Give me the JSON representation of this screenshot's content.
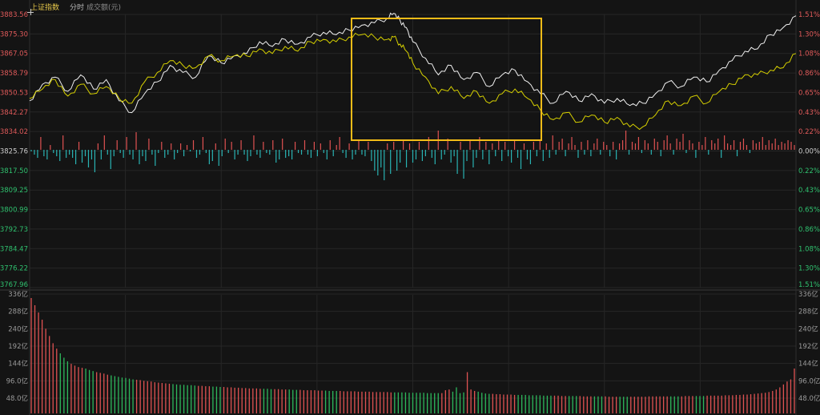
{
  "header": {
    "title": "上证指数",
    "mode": "分时",
    "volume_label": "成交额(元)"
  },
  "colors": {
    "background": "#141414",
    "grid": "#262626",
    "up": "#e05252",
    "down": "#29b3b3",
    "index_line": "#f0f0f0",
    "avg_line": "#d6d000",
    "label_red": "#e05a5a",
    "label_green": "#2fc06e",
    "label_neutral": "#cfcfcf",
    "highlight_box": "#f2bc18"
  },
  "chart_data": [
    {
      "type": "line",
      "name": "price",
      "y_axis_left": {
        "labels": [
          "3883.56",
          "3875.30",
          "3867.05",
          "3858.79",
          "3850.53",
          "3842.27",
          "3834.02",
          "3825.76",
          "3817.50",
          "3809.25",
          "3800.99",
          "3792.73",
          "3784.47",
          "3776.22",
          "3767.96"
        ],
        "ylim": [
          3767.96,
          3883.56
        ]
      },
      "y_axis_right": {
        "labels": [
          "1.51%",
          "1.30%",
          "1.08%",
          "0.86%",
          "0.65%",
          "0.43%",
          "0.22%",
          "0.00%",
          "0.22%",
          "0.43%",
          "0.65%",
          "0.86%",
          "1.08%",
          "1.30%",
          "1.51%"
        ]
      },
      "x_range": [
        0,
        240
      ],
      "series": [
        {
          "points": [
            [
              0,
              3847
            ],
            [
              4,
              3854
            ],
            [
              8,
              3857
            ],
            [
              12,
              3851
            ],
            [
              16,
              3858
            ],
            [
              20,
              3852
            ],
            [
              24,
              3856
            ],
            [
              28,
              3847
            ],
            [
              32,
              3842
            ],
            [
              36,
              3850
            ],
            [
              40,
              3855
            ],
            [
              44,
              3862
            ],
            [
              48,
              3859
            ],
            [
              52,
              3857
            ],
            [
              56,
              3866
            ],
            [
              60,
              3863
            ],
            [
              64,
              3866
            ],
            [
              68,
              3867
            ],
            [
              72,
              3872
            ],
            [
              76,
              3870
            ],
            [
              80,
              3873
            ],
            [
              84,
              3871
            ],
            [
              88,
              3874
            ],
            [
              92,
              3876
            ],
            [
              96,
              3875
            ],
            [
              100,
              3877
            ],
            [
              104,
              3879
            ],
            [
              108,
              3880
            ],
            [
              112,
              3882
            ],
            [
              114,
              3884
            ],
            [
              116,
              3881
            ],
            [
              118,
              3878
            ],
            [
              120,
              3872
            ],
            [
              124,
              3865
            ],
            [
              128,
              3858
            ],
            [
              132,
              3862
            ],
            [
              136,
              3856
            ],
            [
              140,
              3859
            ],
            [
              144,
              3853
            ],
            [
              148,
              3858
            ],
            [
              152,
              3860
            ],
            [
              156,
              3855
            ],
            [
              160,
              3850
            ],
            [
              164,
              3846
            ],
            [
              168,
              3851
            ],
            [
              172,
              3847
            ],
            [
              176,
              3850
            ],
            [
              180,
              3846
            ],
            [
              184,
              3848
            ],
            [
              188,
              3845
            ],
            [
              192,
              3846
            ],
            [
              196,
              3850
            ],
            [
              200,
              3855
            ],
            [
              204,
              3853
            ],
            [
              208,
              3857
            ],
            [
              212,
              3855
            ],
            [
              216,
              3860
            ],
            [
              220,
              3864
            ],
            [
              224,
              3868
            ],
            [
              228,
              3869
            ],
            [
              232,
              3875
            ],
            [
              236,
              3878
            ],
            [
              240,
              3883
            ]
          ]
        },
        {
          "points": [
            [
              0,
              3848
            ],
            [
              4,
              3852
            ],
            [
              8,
              3856
            ],
            [
              12,
              3849
            ],
            [
              16,
              3854
            ],
            [
              20,
              3850
            ],
            [
              24,
              3853
            ],
            [
              28,
              3848
            ],
            [
              32,
              3846
            ],
            [
              36,
              3855
            ],
            [
              40,
              3859
            ],
            [
              44,
              3864
            ],
            [
              48,
              3862
            ],
            [
              52,
              3861
            ],
            [
              56,
              3866
            ],
            [
              60,
              3864
            ],
            [
              64,
              3866
            ],
            [
              68,
              3866
            ],
            [
              72,
              3869
            ],
            [
              76,
              3867
            ],
            [
              80,
              3870
            ],
            [
              84,
              3868
            ],
            [
              88,
              3872
            ],
            [
              92,
              3873
            ],
            [
              96,
              3872
            ],
            [
              100,
              3874
            ],
            [
              104,
              3875
            ],
            [
              108,
              3874
            ],
            [
              112,
              3873
            ],
            [
              114,
              3874
            ],
            [
              116,
              3871
            ],
            [
              118,
              3868
            ],
            [
              120,
              3863
            ],
            [
              124,
              3857
            ],
            [
              128,
              3850
            ],
            [
              132,
              3853
            ],
            [
              136,
              3848
            ],
            [
              140,
              3851
            ],
            [
              144,
              3846
            ],
            [
              148,
              3850
            ],
            [
              152,
              3852
            ],
            [
              156,
              3848
            ],
            [
              160,
              3843
            ],
            [
              164,
              3839
            ],
            [
              168,
              3842
            ],
            [
              172,
              3838
            ],
            [
              176,
              3841
            ],
            [
              180,
              3838
            ],
            [
              184,
              3840
            ],
            [
              188,
              3836
            ],
            [
              192,
              3836
            ],
            [
              196,
              3841
            ],
            [
              200,
              3847
            ],
            [
              204,
              3845
            ],
            [
              208,
              3849
            ],
            [
              212,
              3846
            ],
            [
              216,
              3851
            ],
            [
              220,
              3854
            ],
            [
              224,
              3858
            ],
            [
              228,
              3858
            ],
            [
              232,
              3860
            ],
            [
              236,
              3861
            ],
            [
              240,
              3867
            ]
          ]
        }
      ]
    },
    {
      "type": "bar",
      "name": "diff",
      "ylim": [
        -2.2,
        2.2
      ],
      "values": [
        -0.1,
        -0.3,
        -0.5,
        0.8,
        -0.4,
        -0.6,
        0.3,
        -0.2,
        -0.4,
        -0.7,
        0.9,
        -0.5,
        -0.3,
        -0.5,
        -0.9,
        0.5,
        -0.8,
        -0.4,
        -1.1,
        -0.6,
        -1.4,
        0.4,
        -0.6,
        0.9,
        -0.3,
        -1.2,
        -0.4,
        0.6,
        -0.2,
        -0.5,
        0.8,
        -0.3,
        -0.6,
        1.1,
        -0.9,
        -0.4,
        -0.7,
        0.7,
        -0.3,
        -1.0,
        -0.2,
        0.5,
        -0.5,
        -0.3,
        0.4,
        -0.6,
        -0.2,
        0.4,
        -0.4,
        0.3,
        -0.1,
        0.6,
        -0.5,
        -0.3,
        0.8,
        -0.2,
        -0.9,
        -0.7,
        0.4,
        -1.0,
        -0.4,
        0.7,
        -0.2,
        0.5,
        -0.6,
        -0.3,
        0.6,
        -0.3,
        -0.7,
        -0.4,
        0.9,
        -0.3,
        -0.5,
        0.5,
        -0.2,
        -0.3,
        0.6,
        -0.8,
        -0.6,
        0.7,
        -0.5,
        -0.4,
        -0.6,
        0.5,
        -0.2,
        -0.3,
        0.6,
        -0.3,
        -0.5,
        0.5,
        -0.4,
        0.4,
        -0.2,
        -0.6,
        0.6,
        -0.4,
        0.3,
        0.8,
        -0.2,
        -0.5,
        0.4,
        -0.6,
        -0.3,
        0.6,
        -0.3,
        -0.4,
        0.5,
        -0.7,
        -1.3,
        -1.6,
        -1.1,
        -1.9,
        0.4,
        -1.5,
        0.5,
        -1.3,
        -0.8,
        0.6,
        -1.1,
        0.4,
        -0.8,
        -0.6,
        0.5,
        -0.7,
        -0.4,
        0.8,
        -0.5,
        -0.9,
        1.2,
        -0.6,
        -0.3,
        0.7,
        -0.8,
        -0.4,
        -1.5,
        0.5,
        -1.8,
        -0.7,
        0.6,
        -1.1,
        -0.5,
        0.8,
        -0.6,
        0.5,
        -0.9,
        0.4,
        -0.4,
        0.6,
        -0.7,
        0.5,
        -0.4,
        -0.8,
        0.6,
        -0.5,
        -1.2,
        0.4,
        -0.6,
        -0.9,
        0.5,
        -0.4,
        0.6,
        -0.7,
        0.4,
        -0.5,
        0.9,
        -0.3,
        0.5,
        0.7,
        -0.4,
        0.4,
        0.8,
        0.3,
        -0.5,
        0.5,
        -0.3,
        0.6,
        -0.4,
        0.4,
        0.7,
        -0.3,
        0.5,
        0.3,
        -0.4,
        0.5,
        -0.6,
        0.4,
        0.6,
        1.2,
        -0.3,
        0.5,
        0.4,
        0.8,
        -0.2,
        0.6,
        0.4,
        -0.3,
        0.7,
        0.5,
        -0.4,
        0.6,
        0.9,
        0.4,
        -0.3,
        0.7,
        0.5,
        1.0,
        -0.2,
        0.6,
        0.4,
        -0.5,
        0.5,
        0.3,
        0.8,
        -0.3,
        0.6,
        0.4,
        0.7,
        -0.5,
        0.9,
        0.4,
        0.3,
        0.6,
        -0.4,
        0.5,
        0.7,
        0.3,
        -0.2,
        0.6,
        0.4,
        0.5,
        0.8,
        0.3,
        0.6,
        0.4,
        0.7,
        0.3,
        0.5,
        0.4,
        0.6,
        0.5,
        0.3
      ]
    },
    {
      "type": "bar",
      "name": "turnover",
      "y_axis_labels": [
        "336亿",
        "288亿",
        "240亿",
        "192亿",
        "144亿",
        "96.0亿",
        "48.0亿"
      ],
      "ylim": [
        20,
        336
      ],
      "values": [
        325,
        305,
        285,
        265,
        240,
        220,
        200,
        185,
        172,
        160,
        150,
        143,
        138,
        134,
        132,
        130,
        126,
        123,
        120,
        118,
        116,
        113,
        111,
        109,
        107,
        105,
        104,
        102,
        100,
        99,
        98,
        96,
        95,
        94,
        92,
        91,
        90,
        89,
        88,
        87,
        86,
        85,
        85,
        84,
        84,
        83,
        82,
        82,
        81,
        81,
        80,
        80,
        79,
        79,
        78,
        78,
        77,
        77,
        76,
        76,
        75,
        75,
        75,
        74,
        74,
        74,
        73,
        73,
        73,
        72,
        72,
        72,
        71,
        71,
        71,
        70,
        70,
        70,
        70,
        69,
        69,
        69,
        68,
        68,
        68,
        68,
        67,
        67,
        67,
        67,
        66,
        66,
        66,
        66,
        65,
        65,
        65,
        65,
        65,
        64,
        64,
        64,
        64,
        64,
        63,
        63,
        63,
        63,
        63,
        62,
        62,
        62,
        62,
        62,
        70,
        72,
        66,
        78,
        62,
        64,
        120,
        72,
        68,
        66,
        63,
        61,
        60,
        60,
        59,
        59,
        58,
        58,
        58,
        57,
        57,
        57,
        57,
        56,
        56,
        56,
        56,
        55,
        55,
        55,
        55,
        55,
        54,
        54,
        54,
        54,
        54,
        54,
        53,
        53,
        53,
        53,
        53,
        53,
        53,
        52,
        52,
        52,
        52,
        52,
        52,
        52,
        52,
        52,
        52,
        52,
        53,
        53,
        53,
        53,
        53,
        53,
        53,
        53,
        53,
        53,
        54,
        54,
        54,
        54,
        54,
        54,
        55,
        55,
        55,
        55,
        55,
        56,
        56,
        56,
        57,
        57,
        58,
        58,
        59,
        60,
        61,
        62,
        63,
        65,
        68,
        72,
        78,
        86,
        94,
        100,
        130
      ]
    }
  ]
}
